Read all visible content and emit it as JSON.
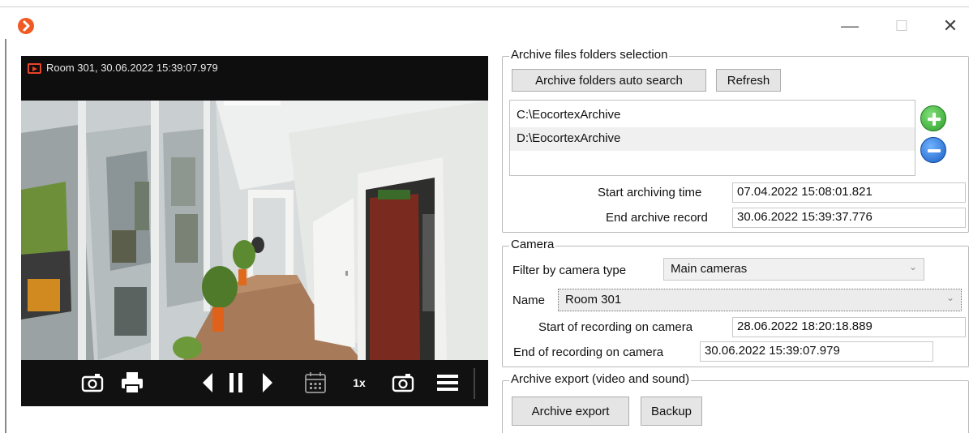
{
  "window": {
    "minimize_glyph": "—",
    "maximize_glyph": "☐",
    "close_glyph": "✕",
    "app_icon": "app-logo-icon"
  },
  "video": {
    "caption": "Room 301, 30.06.2022 15:39:07.979",
    "speed_label": "1x",
    "toolbar_icons": [
      "snapshot-icon",
      "print-icon",
      "step-back-icon",
      "pause-icon",
      "step-forward-icon",
      "calendar-icon",
      "speed-label",
      "camera-snapshot-icon",
      "menu-icon"
    ]
  },
  "archive_folders": {
    "title": "Archive files folders selection",
    "auto_search_label": "Archive folders auto search",
    "refresh_label": "Refresh",
    "folders": [
      "C:\\EocortexArchive",
      "D:\\EocortexArchive"
    ],
    "selected_index": 1,
    "start_archiving_label": "Start archiving time",
    "start_archiving_value": "07.04.2022 15:08:01.821",
    "end_archive_label": "End archive record",
    "end_archive_value": "30.06.2022 15:39:37.776"
  },
  "camera": {
    "title": "Camera",
    "filter_label": "Filter by camera type",
    "filter_value": "Main cameras",
    "name_label": "Name",
    "name_value": "Room 301",
    "start_recording_label": "Start of recording on camera",
    "start_recording_value": "28.06.2022 18:20:18.889",
    "end_recording_label": "End of recording on camera",
    "end_recording_value": "30.06.2022 15:39:07.979"
  },
  "export": {
    "title": "Archive export (video and sound)",
    "export_label": "Archive export",
    "backup_label": "Backup"
  },
  "colors": {
    "accent_orange": "#f15a24",
    "add_green": "#2e9e2a",
    "remove_blue": "#1a5fc4",
    "video_bg": "#000000"
  }
}
